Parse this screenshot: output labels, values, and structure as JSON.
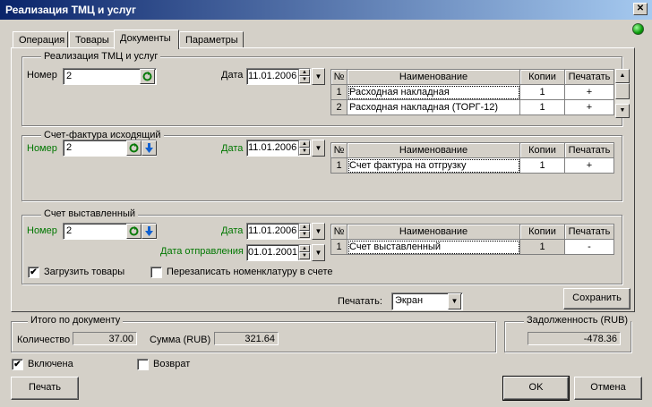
{
  "window": {
    "title": "Реализация ТМЦ и услуг",
    "close_glyph": "✕"
  },
  "tabs": [
    {
      "label": "Операция"
    },
    {
      "label": "Товары"
    },
    {
      "label": "Документы"
    },
    {
      "label": "Параметры"
    }
  ],
  "common": {
    "number_label": "Номер",
    "date_label": "Дата",
    "grid_headers": [
      "№",
      "Наименование",
      "Копии",
      "Печатать"
    ]
  },
  "sales": {
    "group_title": "Реализация ТМЦ и услуг",
    "number": "2",
    "date": "11.01.2006",
    "rows": [
      {
        "n": "1",
        "name": "Расходная накладная",
        "copies": "1",
        "print": "+"
      },
      {
        "n": "2",
        "name": "Расходная накладная (ТОРГ-12)",
        "copies": "1",
        "print": "+"
      }
    ]
  },
  "invoice": {
    "group_title": "Счет-фактура исходящий",
    "number": "2",
    "date": "11.01.2006",
    "rows": [
      {
        "n": "1",
        "name": "Счет фактура на отгрузку",
        "copies": "1",
        "print": "+"
      }
    ]
  },
  "bill": {
    "group_title": "Счет выставленный",
    "number": "2",
    "date": "11.01.2006",
    "send_date_label": "Дата отправления",
    "send_date": "01.01.2001",
    "rows": [
      {
        "n": "1",
        "name": "Счет выставленный",
        "copies": "1",
        "print": "-"
      }
    ],
    "load_goods_label": "Загрузить товары",
    "load_goods_checked": "✔",
    "rewrite_label": "Перезаписать номенклатуру в счете"
  },
  "print_target": {
    "label": "Печатать:",
    "value": "Экран"
  },
  "save_label": "Сохранить",
  "totals": {
    "group_title": "Итого по документу",
    "qty_label": "Количество",
    "qty": "37.00",
    "sum_label": "Сумма (RUB)",
    "sum": "321.64"
  },
  "debt": {
    "group_title": "Задолженность (RUB)",
    "value": "-478.36"
  },
  "included": {
    "label": "Включена",
    "checked": "✔"
  },
  "refund": {
    "label": "Возврат"
  },
  "buttons": {
    "print": "Печать",
    "ok": "OK",
    "cancel": "Отмена"
  },
  "colors": {
    "title_start": "#0a246a",
    "title_end": "#a6caf0",
    "label_green": "#007700",
    "face": "#d4d0c8"
  }
}
